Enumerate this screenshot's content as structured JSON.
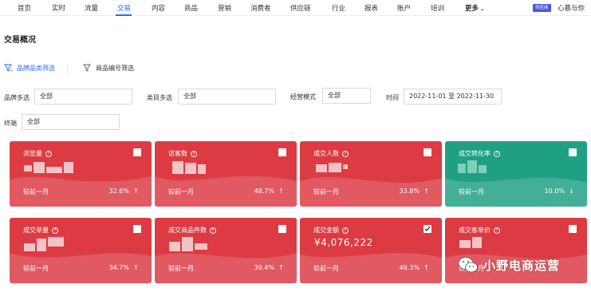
{
  "nav": {
    "items": [
      "首页",
      "实时",
      "流量",
      "交易",
      "内容",
      "商品",
      "营销",
      "消费者",
      "供应链",
      "行业",
      "报表",
      "账户",
      "培训"
    ],
    "active_index": 3,
    "more_label": "更多",
    "role_badge": "供应商",
    "username": "心慕与你"
  },
  "page_title": "交易概况",
  "filter_tabs": {
    "brand_category": "品牌品类筛选",
    "product_code": "商品编号筛选"
  },
  "filters": {
    "brand": {
      "label": "品牌多选",
      "value": "全部"
    },
    "category": {
      "label": "类目多选",
      "value": "全部"
    },
    "mode": {
      "label": "经营模式",
      "value": "全部"
    },
    "time": {
      "label": "时间",
      "value": "2022-11-01 至 2022-11-30"
    },
    "terminal": {
      "label": "终端",
      "value": "全部"
    }
  },
  "cards": [
    {
      "title": "浏览量",
      "compare_label": "较前一月",
      "change": "32.6%",
      "trend": "up",
      "checked": false,
      "color": "red"
    },
    {
      "title": "访客数",
      "compare_label": "较前一月",
      "change": "48.7%",
      "trend": "up",
      "checked": false,
      "color": "red"
    },
    {
      "title": "成交人数",
      "compare_label": "较前一月",
      "change": "33.8%",
      "trend": "up",
      "checked": false,
      "color": "red"
    },
    {
      "title": "成交转化率",
      "compare_label": "较前一月",
      "change": "10.0%",
      "trend": "down",
      "checked": false,
      "color": "green"
    },
    {
      "title": "成交单量",
      "compare_label": "较前一月",
      "change": "34.7%",
      "trend": "up",
      "checked": false,
      "color": "red"
    },
    {
      "title": "成交商品件数",
      "compare_label": "较前一月",
      "change": "39.4%",
      "trend": "up",
      "checked": false,
      "color": "red"
    },
    {
      "title": "成交金额",
      "value": "¥4,076,222",
      "compare_label": "较前一月",
      "change": "49.3%",
      "trend": "up",
      "checked": true,
      "color": "red"
    },
    {
      "title": "成交客单价",
      "compare_label": "较前一月",
      "change": "",
      "trend": "",
      "checked": false,
      "color": "red"
    }
  ],
  "watermark": {
    "text": "小野电商运营",
    "icon": "wechat-icon"
  },
  "colors": {
    "accent": "#2f6bf0",
    "card_red": "#dc3b43",
    "card_green": "#1fa082"
  }
}
